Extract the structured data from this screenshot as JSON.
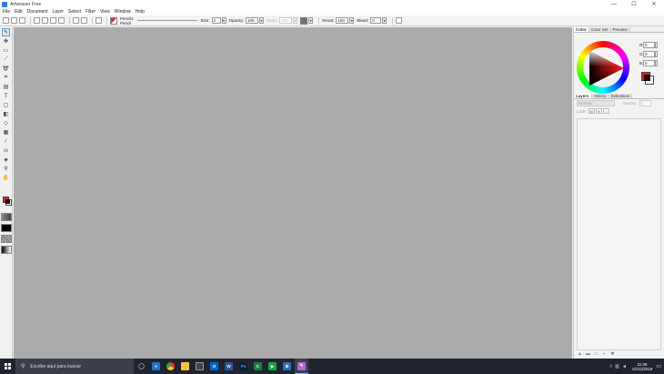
{
  "window": {
    "title": "Artweaver Free",
    "controls": [
      "—",
      "☐",
      "✕"
    ]
  },
  "menu": [
    "File",
    "Edit",
    "Document",
    "Layer",
    "Select",
    "Filter",
    "View",
    "Window",
    "Help"
  ],
  "toolbar": {
    "preset_category": "Pencils",
    "preset_name": "Pencil",
    "size_label": "Size:",
    "size_value": "2",
    "opacity_label": "Opacity:",
    "opacity_value": "100",
    "grain_label": "Grain:",
    "grain_value": "100",
    "resat_label": "Resat:",
    "resat_value": "100",
    "bleed_label": "Bleed:",
    "bleed_value": "0"
  },
  "color_panel": {
    "tabs": [
      "Color",
      "Color Set",
      "Preview"
    ],
    "active_tab": "Color",
    "r_label": "R:",
    "r_value": "0",
    "g_label": "G:",
    "g_value": "0",
    "b_label": "B:",
    "b_value": "0",
    "foreground": "#e0202a",
    "background": "#ffffff"
  },
  "layers_panel": {
    "tabs": [
      "Layers",
      "History",
      "Selections"
    ],
    "active_tab": "Layers",
    "blend_mode": "Normal",
    "opacity_label": "Opacity:",
    "opacity_value": "0",
    "locks_label": "Lock:"
  },
  "canvas": {
    "color": "#ababab"
  },
  "taskbar": {
    "search_placeholder": "Escribe aquí para buscar",
    "apps": [
      "task-view",
      "edge",
      "chrome",
      "file-explorer",
      "store",
      "outlook",
      "word",
      "photoshop",
      "camtasia",
      "green-app",
      "settings",
      "artweaver"
    ],
    "time": "11:36",
    "date": "12/12/2019"
  }
}
